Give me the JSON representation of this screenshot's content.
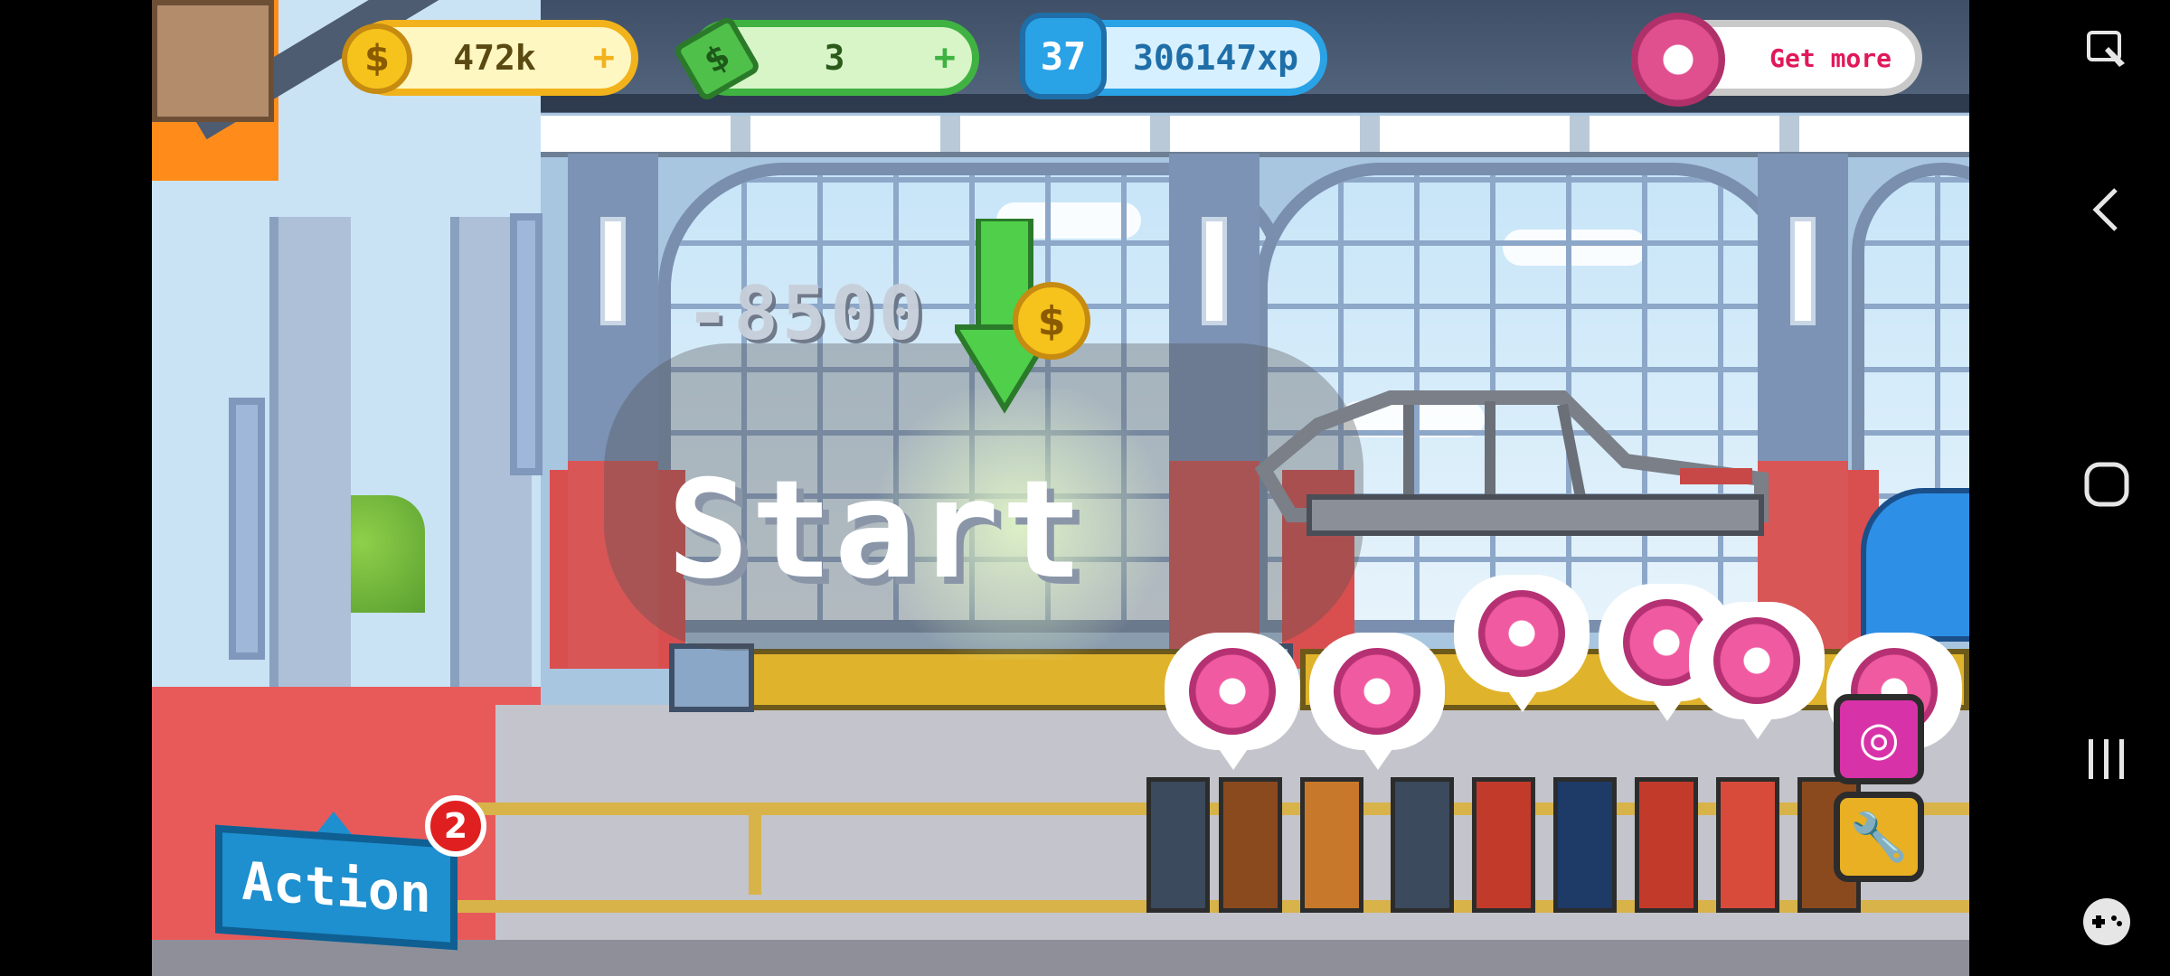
{
  "hud": {
    "coins": "472k",
    "cash": "3",
    "level": "37",
    "xp": "306147xp",
    "donut_cta": "Get more"
  },
  "main": {
    "cost": "-8500",
    "start_label": "Start"
  },
  "action": {
    "label": "Action",
    "badge_count": "2"
  },
  "icons": {
    "coin": "dollar-coin-icon",
    "cash": "cash-icon",
    "level": "level-star-icon",
    "donut": "donut-icon",
    "wrench": "wrench-icon",
    "nav_back": "back-icon",
    "nav_home": "home-icon",
    "nav_recents": "recents-icon"
  },
  "colors": {
    "coin": "#f6c21c",
    "cash": "#3fb242",
    "xp": "#2aa2e6",
    "donut": "#e0508f",
    "action": "#1e8fcf"
  }
}
